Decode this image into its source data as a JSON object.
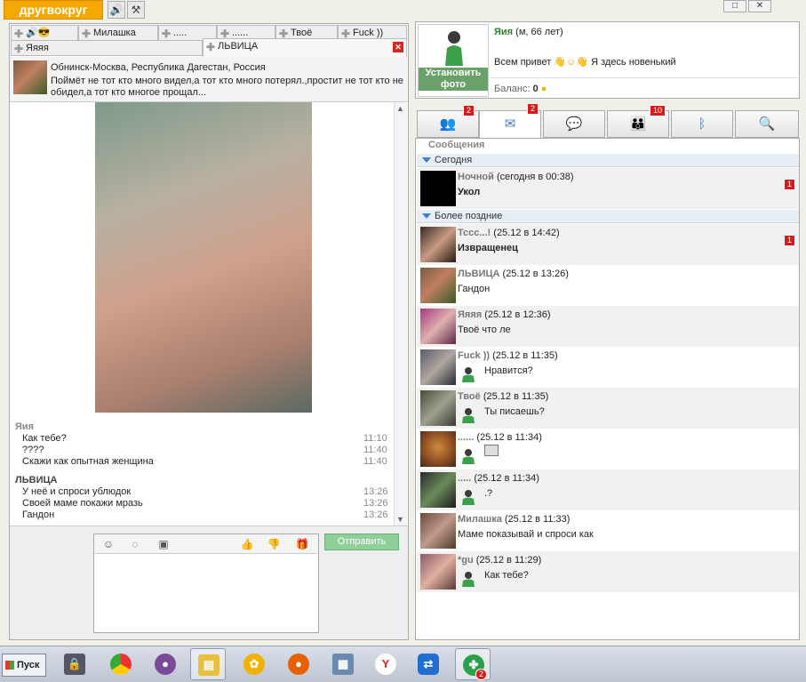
{
  "app": {
    "logo": "другвокруг"
  },
  "window_controls": [
    "□",
    "✕"
  ],
  "left": {
    "tabs_row1": [
      "🔊😎",
      "Милашка",
      ".....",
      "......",
      "Твоё",
      "Fuck ))"
    ],
    "tabs_row2": [
      "Яяяя",
      "ЛЬВИЦА"
    ],
    "profile": {
      "location": "Обнинск-Москва, Республика Дагестан, Россия",
      "status": "Поймёт не тот кто много видел,а тот кто много потерял.,простит не тот кто не обидел,а тот кто многое прощал..."
    },
    "messages": [
      {
        "sender": "Яия",
        "lines": [
          {
            "text": "Как тебе?",
            "time": "11:10"
          },
          {
            "text": "????",
            "time": "11:40"
          },
          {
            "text": "Скажи как опытная женщина",
            "time": "11:40"
          }
        ]
      },
      {
        "sender": "ЛЬВИЦА",
        "lines": [
          {
            "text": "У неё и спроси ублюдок",
            "time": "13:26"
          },
          {
            "text": "Своей маме покажи мразь",
            "time": "13:26"
          },
          {
            "text": "Гандон",
            "time": "13:26"
          }
        ]
      }
    ],
    "send_label": "Отправить"
  },
  "right": {
    "set_photo": "Установить фото",
    "user": {
      "name": "Яия",
      "meta": "(м, 66 лет)"
    },
    "greeting_left": "Всем привет",
    "greeting_right": "Я здесь новенький",
    "balance_label": "Баланс:",
    "balance_value": "0",
    "tab_badges": [
      "2",
      "2",
      "10"
    ],
    "list_title": "Сообщения",
    "sections": [
      "Сегодня",
      "Более поздние"
    ],
    "conversations": [
      {
        "name": "Ночной",
        "when": "(сегодня в 00:38)",
        "text": "Укол",
        "bold": true,
        "count": "1"
      },
      {
        "name": "Тссс...!",
        "when": "(25.12 в 14:42)",
        "text": "Извращенец",
        "bold": true,
        "count": "1"
      },
      {
        "name": "ЛЬВИЦА",
        "when": "(25.12 в 13:26)",
        "text": "Гандон"
      },
      {
        "name": "Яяяя",
        "when": "(25.12 в 12:36)",
        "text": "Твоё что ле"
      },
      {
        "name": "Fuck ))",
        "when": "(25.12 в 11:35)",
        "text": "Нравится?",
        "mine": true
      },
      {
        "name": "Твоё",
        "when": "(25.12 в 11:35)",
        "text": "Ты писаешь?",
        "mine": true
      },
      {
        "name": "......",
        "when": "(25.12 в 11:34)",
        "text": "",
        "mine": true,
        "image": true
      },
      {
        "name": ".....",
        "when": "(25.12 в 11:34)",
        "text": ".?",
        "mine": true
      },
      {
        "name": "Милашка",
        "when": "(25.12 в 11:33)",
        "text": "Маме показывай и спроси как"
      },
      {
        "name": "*gu",
        "when": "(25.12 в 11:29)",
        "text": "Как тебе?",
        "mine": true
      }
    ]
  },
  "taskbar": {
    "start_label": "Пуск",
    "apps_badge": "2"
  }
}
